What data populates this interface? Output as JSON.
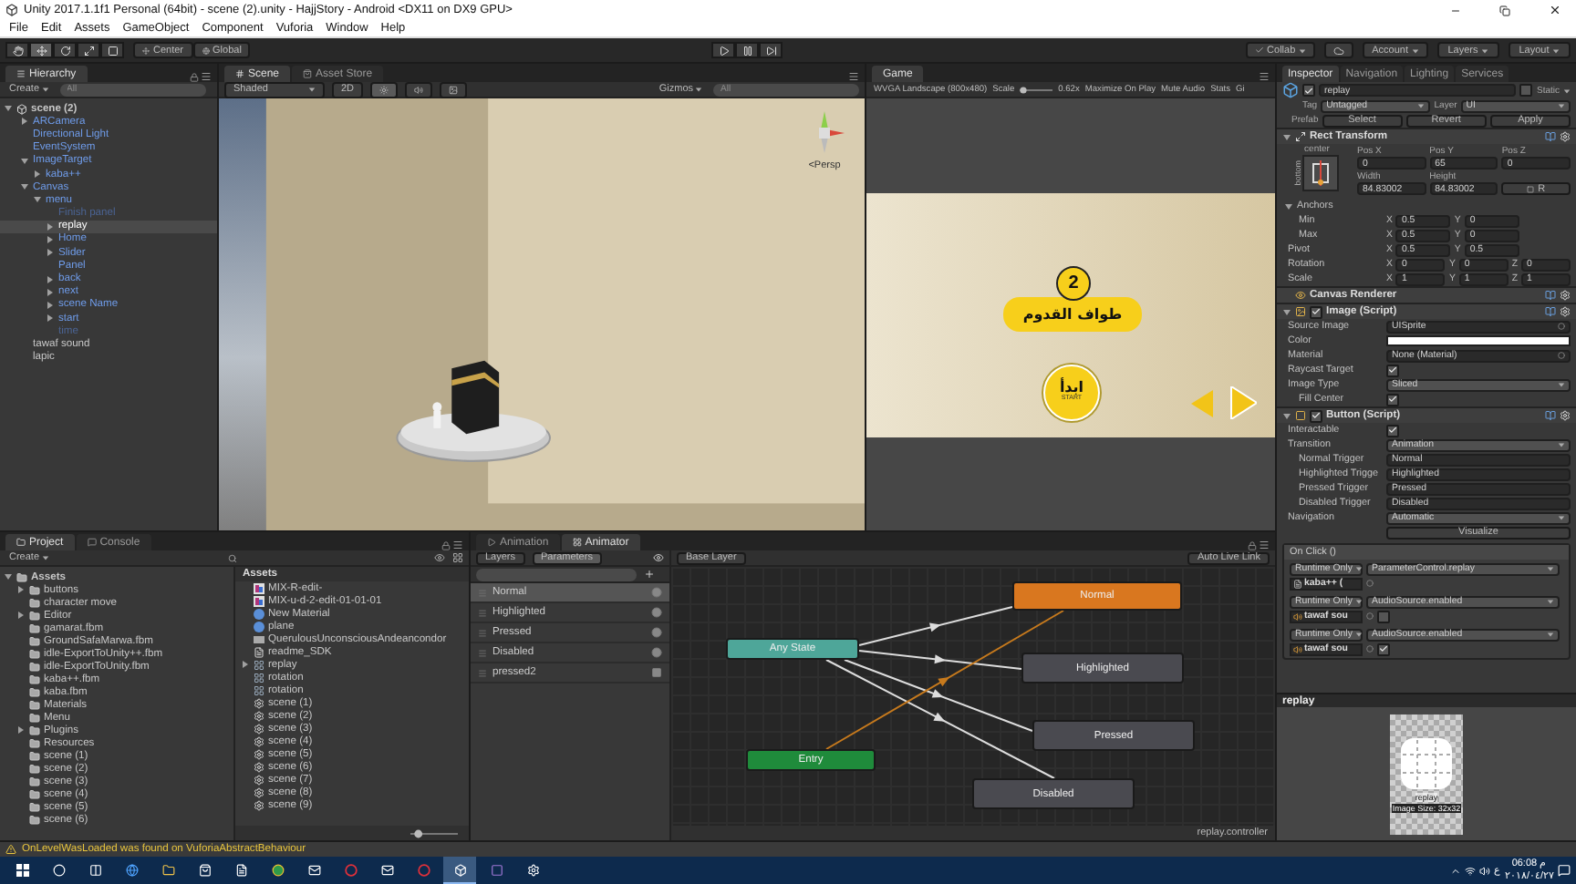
{
  "window": {
    "title": "Unity 2017.1.1f1 Personal (64bit) - scene (2).unity - HajjStory - Android <DX11 on DX9 GPU>"
  },
  "menu": [
    "File",
    "Edit",
    "Assets",
    "GameObject",
    "Component",
    "Vuforia",
    "Window",
    "Help"
  ],
  "toolbar": {
    "tools": [
      {
        "kind": "hand",
        "selected": false
      },
      {
        "kind": "move",
        "selected": true
      },
      {
        "kind": "rotate",
        "selected": false
      },
      {
        "kind": "scale",
        "selected": false
      },
      {
        "kind": "rect",
        "selected": false
      }
    ],
    "pivot": "Center",
    "space": "Global",
    "collab": "Collab",
    "account": "Account",
    "layers": "Layers",
    "layout": "Layout"
  },
  "hierarchy": {
    "tab": "Hierarchy",
    "create": "Create",
    "search_placeholder": "All",
    "scene": {
      "name": "scene (2)",
      "expanded": true,
      "children": [
        {
          "name": "ARCamera",
          "kind": "prefab",
          "selected": false,
          "expanded": false
        },
        {
          "name": "Directional Light",
          "kind": "prefab",
          "selected": false
        },
        {
          "name": "EventSystem",
          "kind": "prefab",
          "selected": false
        },
        {
          "name": "ImageTarget",
          "kind": "prefab",
          "selected": false,
          "expanded": true,
          "children": [
            {
              "name": "kaba++",
              "kind": "prefab",
              "selected": false,
              "expanded": false
            }
          ]
        },
        {
          "name": "Canvas",
          "kind": "prefab",
          "selected": false,
          "expanded": true,
          "children": [
            {
              "name": "menu",
              "kind": "prefab",
              "selected": false,
              "expanded": true,
              "children": [
                {
                  "name": "Finish panel",
                  "kind": "inactive",
                  "selected": false
                },
                {
                  "name": "replay",
                  "kind": "prefab",
                  "selected": true,
                  "expanded": false
                },
                {
                  "name": "Home",
                  "kind": "prefab",
                  "selected": false,
                  "expanded": false
                },
                {
                  "name": "Slider",
                  "kind": "prefab",
                  "selected": false,
                  "expanded": false
                },
                {
                  "name": "Panel",
                  "kind": "prefab",
                  "selected": false
                },
                {
                  "name": "back",
                  "kind": "prefab",
                  "selected": false,
                  "expanded": false
                },
                {
                  "name": "next",
                  "kind": "prefab",
                  "selected": false,
                  "expanded": false
                },
                {
                  "name": "scene Name",
                  "kind": "prefab",
                  "selected": false,
                  "expanded": false
                },
                {
                  "name": "start",
                  "kind": "prefab",
                  "selected": false,
                  "expanded": false
                },
                {
                  "name": "time",
                  "kind": "inactive",
                  "selected": false
                }
              ]
            }
          ]
        },
        {
          "name": "tawaf sound",
          "kind": "object",
          "selected": false
        },
        {
          "name": "lapic",
          "kind": "object",
          "selected": false
        }
      ]
    }
  },
  "scene": {
    "tabs": [
      {
        "label": "Scene",
        "selected": true
      },
      {
        "label": "Asset Store",
        "selected": false
      }
    ],
    "shading": "Shaded",
    "mode_2d": "2D",
    "toggles": [
      {
        "kind": "lighting",
        "on": true
      },
      {
        "kind": "audio",
        "on": false
      },
      {
        "kind": "effects",
        "on": false
      }
    ],
    "gizmos": "Gizmos",
    "search_placeholder": "All",
    "projection": "<Persp"
  },
  "game": {
    "tab": "Game",
    "resolution": "WVGA Landscape (800x480)",
    "scale_label": "Scale",
    "scale_slider": {
      "level": 0.1
    },
    "scale": "0.62x",
    "toggles": [
      "Maximize On Play",
      "Mute Audio",
      "Stats",
      "Gi"
    ],
    "screen": {
      "step": "2",
      "title": "طواف القدوم",
      "start": "ابدأ",
      "start_en": "START"
    }
  },
  "inspector": {
    "tabs": [
      {
        "label": "Inspector",
        "selected": true
      },
      {
        "label": "Navigation",
        "selected": false
      },
      {
        "label": "Lighting",
        "selected": false
      },
      {
        "label": "Services",
        "selected": false
      }
    ],
    "object": {
      "active": true,
      "name": "replay",
      "static_label": "Static",
      "static": false,
      "tag_label": "Tag",
      "tag": "Untagged",
      "layer_label": "Layer",
      "layer": "UI",
      "prefab_label": "Prefab",
      "prefab_buttons": [
        "Select",
        "Revert",
        "Apply"
      ]
    },
    "rect_transform": {
      "title": "Rect Transform",
      "expanded": true,
      "anchor_h": "center",
      "anchor_v": "bottom",
      "pos_labels": [
        "Pos X",
        "Pos Y",
        "Pos Z"
      ],
      "pos_values": [
        "0",
        "65",
        "0"
      ],
      "size_labels": [
        "Width",
        "Height"
      ],
      "size_values": [
        "84.83002",
        "84.83002"
      ],
      "raw_button": "R",
      "anchors": {
        "label": "Anchors",
        "expanded": true,
        "rows": [
          {
            "label": "Min",
            "axes": [
              {
                "axis": "X",
                "value": "0.5"
              },
              {
                "axis": "Y",
                "value": "0"
              }
            ]
          },
          {
            "label": "Max",
            "axes": [
              {
                "axis": "X",
                "value": "0.5"
              },
              {
                "axis": "Y",
                "value": "0"
              }
            ]
          }
        ]
      },
      "vectors": [
        {
          "label": "Pivot",
          "axes": [
            {
              "axis": "X",
              "value": "0.5"
            },
            {
              "axis": "Y",
              "value": "0.5"
            }
          ]
        },
        {
          "label": "Rotation",
          "axes": [
            {
              "axis": "X",
              "value": "0"
            },
            {
              "axis": "Y",
              "value": "0"
            },
            {
              "axis": "Z",
              "value": "0"
            }
          ]
        },
        {
          "label": "Scale",
          "axes": [
            {
              "axis": "X",
              "value": "1"
            },
            {
              "axis": "Y",
              "value": "1"
            },
            {
              "axis": "Z",
              "value": "1"
            }
          ]
        }
      ]
    },
    "components": [
      {
        "title": "Canvas Renderer",
        "kind": "renderer"
      },
      {
        "title": "Image (Script)",
        "kind": "image",
        "expanded": true,
        "enabled": true,
        "properties": [
          {
            "label": "Source Image",
            "kind": "object",
            "value": "UISprite"
          },
          {
            "label": "Color",
            "kind": "color",
            "color": "#ffffff"
          },
          {
            "label": "Material",
            "kind": "object",
            "value": "None (Material)"
          },
          {
            "label": "Raycast Target",
            "kind": "toggle",
            "checked": true
          },
          {
            "label": "Image Type",
            "kind": "dropdown",
            "value": "Sliced",
            "children": [
              {
                "label": "Fill Center",
                "kind": "toggle",
                "checked": true
              }
            ]
          }
        ]
      },
      {
        "title": "Button (Script)",
        "kind": "button",
        "expanded": true,
        "enabled": true,
        "properties": [
          {
            "label": "Interactable",
            "kind": "toggle",
            "checked": true
          },
          {
            "label": "Transition",
            "kind": "dropdown",
            "value": "Animation",
            "children": [
              {
                "label": "Normal Trigger",
                "kind": "text",
                "value": "Normal"
              },
              {
                "label": "Highlighted Trigge",
                "kind": "text",
                "value": "Highlighted"
              },
              {
                "label": "Pressed Trigger",
                "kind": "text",
                "value": "Pressed"
              },
              {
                "label": "Disabled Trigger",
                "kind": "text",
                "value": "Disabled"
              }
            ]
          },
          {
            "label": "Navigation",
            "kind": "dropdown",
            "value": "Automatic"
          },
          {
            "kind": "button",
            "value": "Visualize"
          }
        ]
      }
    ],
    "on_click": {
      "title": "On Click ()",
      "listeners": [
        {
          "mode": "Runtime Only",
          "function": "ParameterControl.replay",
          "target": "kaba++ (",
          "kind": "script"
        },
        {
          "mode": "Runtime Only",
          "function": "AudioSource.enabled",
          "target": "tawaf sou",
          "kind": "audio",
          "checked": false
        },
        {
          "mode": "Runtime Only",
          "function": "AudioSource.enabled",
          "target": "tawaf sou",
          "kind": "audio",
          "checked": true
        }
      ]
    },
    "preview": {
      "title": "replay",
      "caption": "replay",
      "size": "Image Size: 32x32"
    }
  },
  "project": {
    "tabs": [
      {
        "label": "Project",
        "selected": true
      },
      {
        "label": "Console",
        "selected": false
      }
    ],
    "create": "Create",
    "zoom": {
      "level": 0.1
    },
    "tree": {
      "name": "Assets",
      "expanded": true,
      "children": [
        {
          "name": "buttons",
          "expanded": false
        },
        {
          "name": "character move"
        },
        {
          "name": "Editor",
          "expanded": false
        },
        {
          "name": "gamarat.fbm"
        },
        {
          "name": "GroundSafaMarwa.fbm"
        },
        {
          "name": "idle-ExportToUnity++.fbm"
        },
        {
          "name": "idle-ExportToUnity.fbm"
        },
        {
          "name": "kaba++.fbm"
        },
        {
          "name": "kaba.fbm"
        },
        {
          "name": "Materials"
        },
        {
          "name": "Menu"
        },
        {
          "name": "Plugins",
          "expanded": false
        },
        {
          "name": "Resources"
        },
        {
          "name": "scene (1)"
        },
        {
          "name": "scene (2)"
        },
        {
          "name": "scene (3)"
        },
        {
          "name": "scene (4)"
        },
        {
          "name": "scene (5)"
        },
        {
          "name": "scene (6)"
        }
      ]
    },
    "assets_title": "Assets",
    "assets": [
      {
        "name": "MIX-R-edit-",
        "kind": "texture"
      },
      {
        "name": "MIX-u-d-2-edit-01-01-01",
        "kind": "texture"
      },
      {
        "name": "New Material",
        "kind": "material"
      },
      {
        "name": "plane",
        "kind": "material"
      },
      {
        "name": "QuerulousUnconsciousAndeancondor",
        "kind": "mesh"
      },
      {
        "name": "readme_SDK",
        "kind": "text"
      },
      {
        "name": "replay",
        "kind": "controller",
        "expanded": false
      },
      {
        "name": "rotation",
        "kind": "animation"
      },
      {
        "name": "rotation",
        "kind": "controller"
      },
      {
        "name": "scene (1)",
        "kind": "scene"
      },
      {
        "name": "scene (2)",
        "kind": "scene"
      },
      {
        "name": "scene (3)",
        "kind": "scene"
      },
      {
        "name": "scene (4)",
        "kind": "scene"
      },
      {
        "name": "scene (5)",
        "kind": "scene"
      },
      {
        "name": "scene (6)",
        "kind": "scene"
      },
      {
        "name": "scene (7)",
        "kind": "scene"
      },
      {
        "name": "scene (8)",
        "kind": "scene"
      },
      {
        "name": "scene (9)",
        "kind": "scene"
      }
    ]
  },
  "animator": {
    "tabs": [
      {
        "label": "Animation",
        "selected": false
      },
      {
        "label": "Animator",
        "selected": true
      }
    ],
    "modes": [
      {
        "label": "Layers",
        "selected": false
      },
      {
        "label": "Parameters",
        "selected": true
      }
    ],
    "parameters": [
      {
        "name": "Normal",
        "kind": "trigger",
        "selected": true
      },
      {
        "name": "Highlighted",
        "kind": "trigger",
        "selected": false
      },
      {
        "name": "Pressed",
        "kind": "trigger",
        "selected": false
      },
      {
        "name": "Disabled",
        "kind": "trigger",
        "selected": false
      },
      {
        "name": "pressed2",
        "kind": "bool",
        "selected": false
      }
    ],
    "layer": "Base Layer",
    "live_link": "Auto Live Link",
    "states": [
      {
        "name": "Normal",
        "kind": "default"
      },
      {
        "name": "Any State",
        "kind": "any"
      },
      {
        "name": "Highlighted",
        "kind": "state"
      },
      {
        "name": "Pressed",
        "kind": "state"
      },
      {
        "name": "Entry",
        "kind": "entry"
      },
      {
        "name": "Disabled",
        "kind": "state"
      }
    ],
    "controller": "replay.controller"
  },
  "status": {
    "message": "OnLevelWasLoaded was found on VuforiaAbstractBehaviour"
  },
  "taskbar": {
    "apps": [
      {
        "kind": "windows",
        "active": false
      },
      {
        "kind": "search",
        "active": false
      },
      {
        "kind": "taskview",
        "active": false
      },
      {
        "kind": "browser",
        "active": false
      },
      {
        "kind": "folder",
        "active": false
      },
      {
        "kind": "store",
        "active": false
      },
      {
        "kind": "files",
        "active": false
      },
      {
        "kind": "chrome",
        "active": false
      },
      {
        "kind": "mail",
        "active": false
      },
      {
        "kind": "opera",
        "active": false
      },
      {
        "kind": "mail2",
        "active": false
      },
      {
        "kind": "opera",
        "active": false
      },
      {
        "kind": "unity",
        "active": true
      },
      {
        "kind": "vs",
        "active": false
      },
      {
        "kind": "settings",
        "active": false
      }
    ],
    "lang": "ع",
    "time": "06:08 م",
    "date": "٢٠١٨/٠٤/٢٧"
  }
}
